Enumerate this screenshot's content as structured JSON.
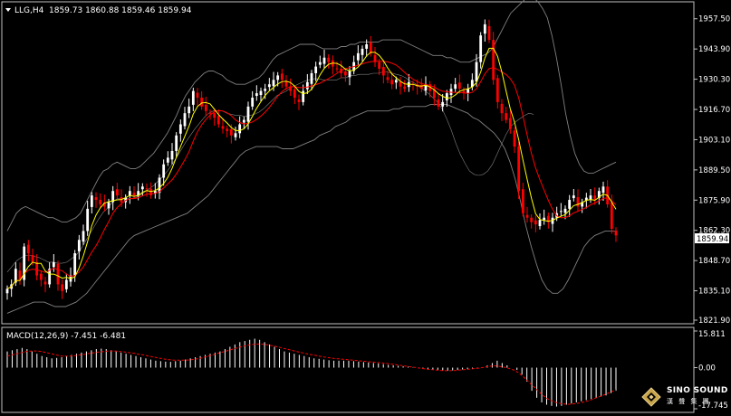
{
  "header": {
    "arrow_icon": "triangle-down-icon",
    "symbol": "LLG,H4",
    "ohlc": "1859.73 1860.88 1859.46 1859.94"
  },
  "macd": {
    "label": "MACD(12,26,9) -7.451 -6.481"
  },
  "brand": {
    "name": "SINO SOUND",
    "subtitle": "漢 聲 集 團",
    "logo_icon": "diamond-logo-icon"
  },
  "colors": {
    "background": "#000000",
    "frame": "#c0c0c0",
    "bull_candle": "#ffffff",
    "bear_candle": "#ff0000",
    "fast_ma": "#ffff00",
    "slow_ma": "#ff0000",
    "bollinger": "#808080",
    "macd_hist": "#ffffff",
    "macd_signal": "#ff0000",
    "price_tag_bg": "#ffffff",
    "price_tag_text": "#000000"
  },
  "chart_data": {
    "type": "candlestick",
    "main": {
      "y_ticks": [
        "1957.50",
        "1943.90",
        "1930.30",
        "1916.70",
        "1903.10",
        "1889.50",
        "1875.90",
        "1862.30",
        "1848.70",
        "1835.10",
        "1821.90"
      ],
      "ylim": [
        1821.9,
        1963.5
      ],
      "last_price": "1859.94",
      "close": [
        1836,
        1838,
        1845,
        1840,
        1855,
        1852,
        1848,
        1842,
        1840,
        1838,
        1845,
        1848,
        1838,
        1835,
        1840,
        1842,
        1852,
        1858,
        1862,
        1872,
        1878,
        1876,
        1874,
        1873,
        1875,
        1880,
        1878,
        1875,
        1877,
        1880,
        1878,
        1880,
        1882,
        1881,
        1878,
        1880,
        1886,
        1892,
        1895,
        1898,
        1905,
        1910,
        1915,
        1918,
        1925,
        1922,
        1918,
        1916,
        1915,
        1913,
        1910,
        1908,
        1907,
        1905,
        1906,
        1910,
        1912,
        1918,
        1922,
        1924,
        1925,
        1926,
        1928,
        1930,
        1932,
        1930,
        1927,
        1925,
        1922,
        1920,
        1925,
        1929,
        1933,
        1936,
        1938,
        1940,
        1938,
        1936,
        1935,
        1933,
        1932,
        1934,
        1938,
        1942,
        1944,
        1946,
        1942,
        1938,
        1935,
        1932,
        1930,
        1928,
        1930,
        1927,
        1926,
        1929,
        1928,
        1927,
        1926,
        1928,
        1925,
        1922,
        1918,
        1920,
        1924,
        1926,
        1928,
        1926,
        1924,
        1926,
        1930,
        1938,
        1950,
        1955,
        1948,
        1930,
        1920,
        1915,
        1912,
        1908,
        1900,
        1880,
        1870,
        1868,
        1866,
        1865,
        1867,
        1868,
        1866,
        1868,
        1870,
        1871,
        1872,
        1876,
        1878,
        1873,
        1875,
        1877,
        1878,
        1876,
        1880,
        1882,
        1874,
        1863,
        1860
      ],
      "bollinger_upper": [
        1862,
        1866,
        1870,
        1872,
        1873,
        1872,
        1871,
        1870,
        1869,
        1868,
        1868,
        1867,
        1866,
        1866,
        1867,
        1868,
        1870,
        1874,
        1878,
        1882,
        1886,
        1889,
        1890,
        1892,
        1893,
        1892,
        1891,
        1890,
        1890,
        1891,
        1893,
        1895,
        1897,
        1900,
        1903,
        1906,
        1910,
        1914,
        1919,
        1923,
        1926,
        1929,
        1931,
        1933,
        1934,
        1934,
        1933,
        1932,
        1930,
        1929,
        1928,
        1928,
        1928,
        1929,
        1930,
        1931,
        1933,
        1936,
        1939,
        1941,
        1942,
        1943,
        1944,
        1945,
        1946,
        1946,
        1946,
        1946,
        1945,
        1944,
        1944,
        1944,
        1944,
        1945,
        1945,
        1946,
        1946,
        1947,
        1947,
        1947,
        1947,
        1947,
        1948,
        1948,
        1948,
        1948,
        1948,
        1947,
        1946,
        1945,
        1944,
        1943,
        1942,
        1941,
        1941,
        1941,
        1940,
        1940,
        1939,
        1938,
        1938,
        1938,
        1939,
        1940,
        1941,
        1942,
        1944,
        1948,
        1952,
        1956,
        1960,
        1962,
        1964,
        1966,
        1968,
        1967,
        1965,
        1962,
        1958,
        1950,
        1940,
        1928,
        1915,
        1905,
        1897,
        1892,
        1889,
        1888,
        1888,
        1889,
        1890,
        1891,
        1892,
        1893
      ],
      "bollinger_lower": [
        1825,
        1826,
        1827,
        1828,
        1829,
        1830,
        1830,
        1830,
        1829,
        1828,
        1828,
        1828,
        1829,
        1830,
        1832,
        1834,
        1837,
        1840,
        1843,
        1846,
        1849,
        1852,
        1855,
        1858,
        1860,
        1861,
        1862,
        1863,
        1864,
        1865,
        1866,
        1867,
        1868,
        1869,
        1870,
        1872,
        1874,
        1876,
        1878,
        1881,
        1884,
        1887,
        1890,
        1893,
        1896,
        1898,
        1899,
        1900,
        1900,
        1900,
        1900,
        1900,
        1899,
        1899,
        1899,
        1900,
        1901,
        1902,
        1903,
        1905,
        1906,
        1907,
        1909,
        1910,
        1911,
        1913,
        1914,
        1915,
        1916,
        1916,
        1916,
        1916,
        1916,
        1917,
        1917,
        1918,
        1918,
        1918,
        1918,
        1918,
        1919,
        1919,
        1919,
        1919,
        1918,
        1917,
        1916,
        1915,
        1913,
        1912,
        1910,
        1908,
        1906,
        1903,
        1899,
        1893,
        1885,
        1875,
        1864,
        1855,
        1847,
        1840,
        1836,
        1834,
        1834,
        1836,
        1840,
        1845,
        1850,
        1855,
        1858,
        1860,
        1861,
        1862,
        1862,
        1862
      ]
    },
    "macd": {
      "y_ticks": [
        "15.811",
        "0.00",
        "-17.745"
      ],
      "ylim": [
        -17.745,
        15.811
      ],
      "histogram": [
        7,
        7.5,
        8,
        8.5,
        8,
        7,
        6,
        5,
        4.5,
        4,
        4.2,
        4.5,
        5,
        5.5,
        6,
        6.5,
        7,
        7.5,
        8,
        8.2,
        8,
        7.5,
        7,
        6.5,
        6,
        5.5,
        5,
        4.5,
        4,
        3.5,
        3,
        2.8,
        2.6,
        2.5,
        2.8,
        3,
        3.5,
        4,
        4.5,
        5,
        5.5,
        6,
        6.5,
        7,
        8,
        9,
        10,
        11,
        11.5,
        12,
        12.5,
        12,
        11,
        10,
        9,
        8,
        7,
        6.5,
        6,
        5.5,
        5,
        4.5,
        4,
        3.8,
        3.5,
        3.2,
        3,
        3,
        3,
        3,
        2.8,
        2.6,
        2.4,
        2.2,
        2,
        1.8,
        1.5,
        1.2,
        1,
        0.8,
        0.6,
        0.4,
        0.2,
        0,
        -0.3,
        -0.6,
        -0.8,
        -1,
        -1.2,
        -1.3,
        -1.2,
        -1,
        -0.8,
        -0.7,
        -0.5,
        -0.3,
        0,
        1,
        2,
        3,
        2,
        1,
        0,
        -1,
        -3,
        -6,
        -10,
        -13,
        -15,
        -16,
        -16.5,
        -16.8,
        -16.5,
        -16,
        -15.5,
        -15,
        -14.5,
        -14,
        -13.5,
        -13,
        -12.5,
        -12,
        -11,
        -10
      ],
      "signal": [
        5,
        5.5,
        6,
        6.5,
        7,
        7.2,
        7.2,
        7,
        6.5,
        6,
        5.5,
        5,
        5,
        5,
        5.2,
        5.5,
        5.8,
        6.2,
        6.5,
        6.8,
        7,
        7.2,
        7.2,
        7,
        6.8,
        6.5,
        6.2,
        5.8,
        5.5,
        5,
        4.6,
        4.2,
        3.8,
        3.5,
        3.3,
        3.2,
        3.2,
        3.3,
        3.5,
        3.8,
        4.2,
        4.8,
        5.4,
        6,
        6.6,
        7.2,
        7.8,
        8.4,
        9,
        9.5,
        9.9,
        10.1,
        10.2,
        10,
        9.6,
        9.2,
        8.7,
        8.2,
        7.7,
        7.2,
        6.7,
        6.2,
        5.8,
        5.4,
        5,
        4.6,
        4.3,
        4,
        3.8,
        3.6,
        3.4,
        3.2,
        3,
        2.8,
        2.6,
        2.4,
        2.2,
        2,
        1.8,
        1.5,
        1.2,
        0.9,
        0.6,
        0.3,
        0,
        -0.3,
        -0.6,
        -0.8,
        -1,
        -1.2,
        -1.3,
        -1.3,
        -1.2,
        -1,
        -0.8,
        -0.6,
        -0.4,
        -0.2,
        0.2,
        0.6,
        0.8,
        0.6,
        0.2,
        -0.3,
        -1,
        -2.2,
        -4,
        -6,
        -8,
        -10,
        -12,
        -13.5,
        -14.5,
        -15.2,
        -15.6,
        -15.8,
        -15.7,
        -15.4,
        -15,
        -14.5,
        -13.8,
        -13,
        -12.2,
        -11.4,
        -10.5,
        -9.5
      ]
    }
  }
}
